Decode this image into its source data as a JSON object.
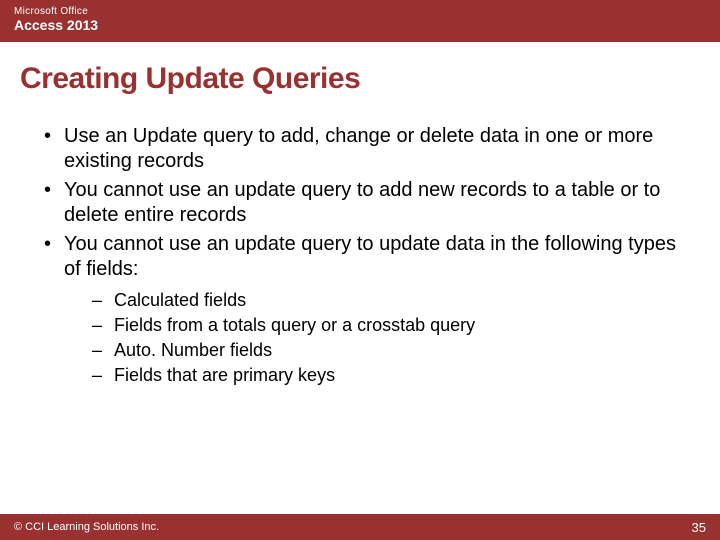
{
  "header": {
    "brand": "Microsoft Office",
    "product": "Access 2013"
  },
  "title": "Creating Update Queries",
  "bullets": [
    "Use an Update query to add, change or delete data in one or more existing records",
    "You cannot use an update query to add new records to a table or to delete entire records",
    "You cannot use an update query to update data in the following types of fields:"
  ],
  "subbullets": [
    "Calculated fields",
    "Fields from a totals query or a crosstab query",
    "Auto. Number fields",
    "Fields that are primary keys"
  ],
  "footer": {
    "copyright": "© CCI Learning Solutions Inc.",
    "page": "35"
  },
  "colors": {
    "accent": "#9a3131"
  }
}
